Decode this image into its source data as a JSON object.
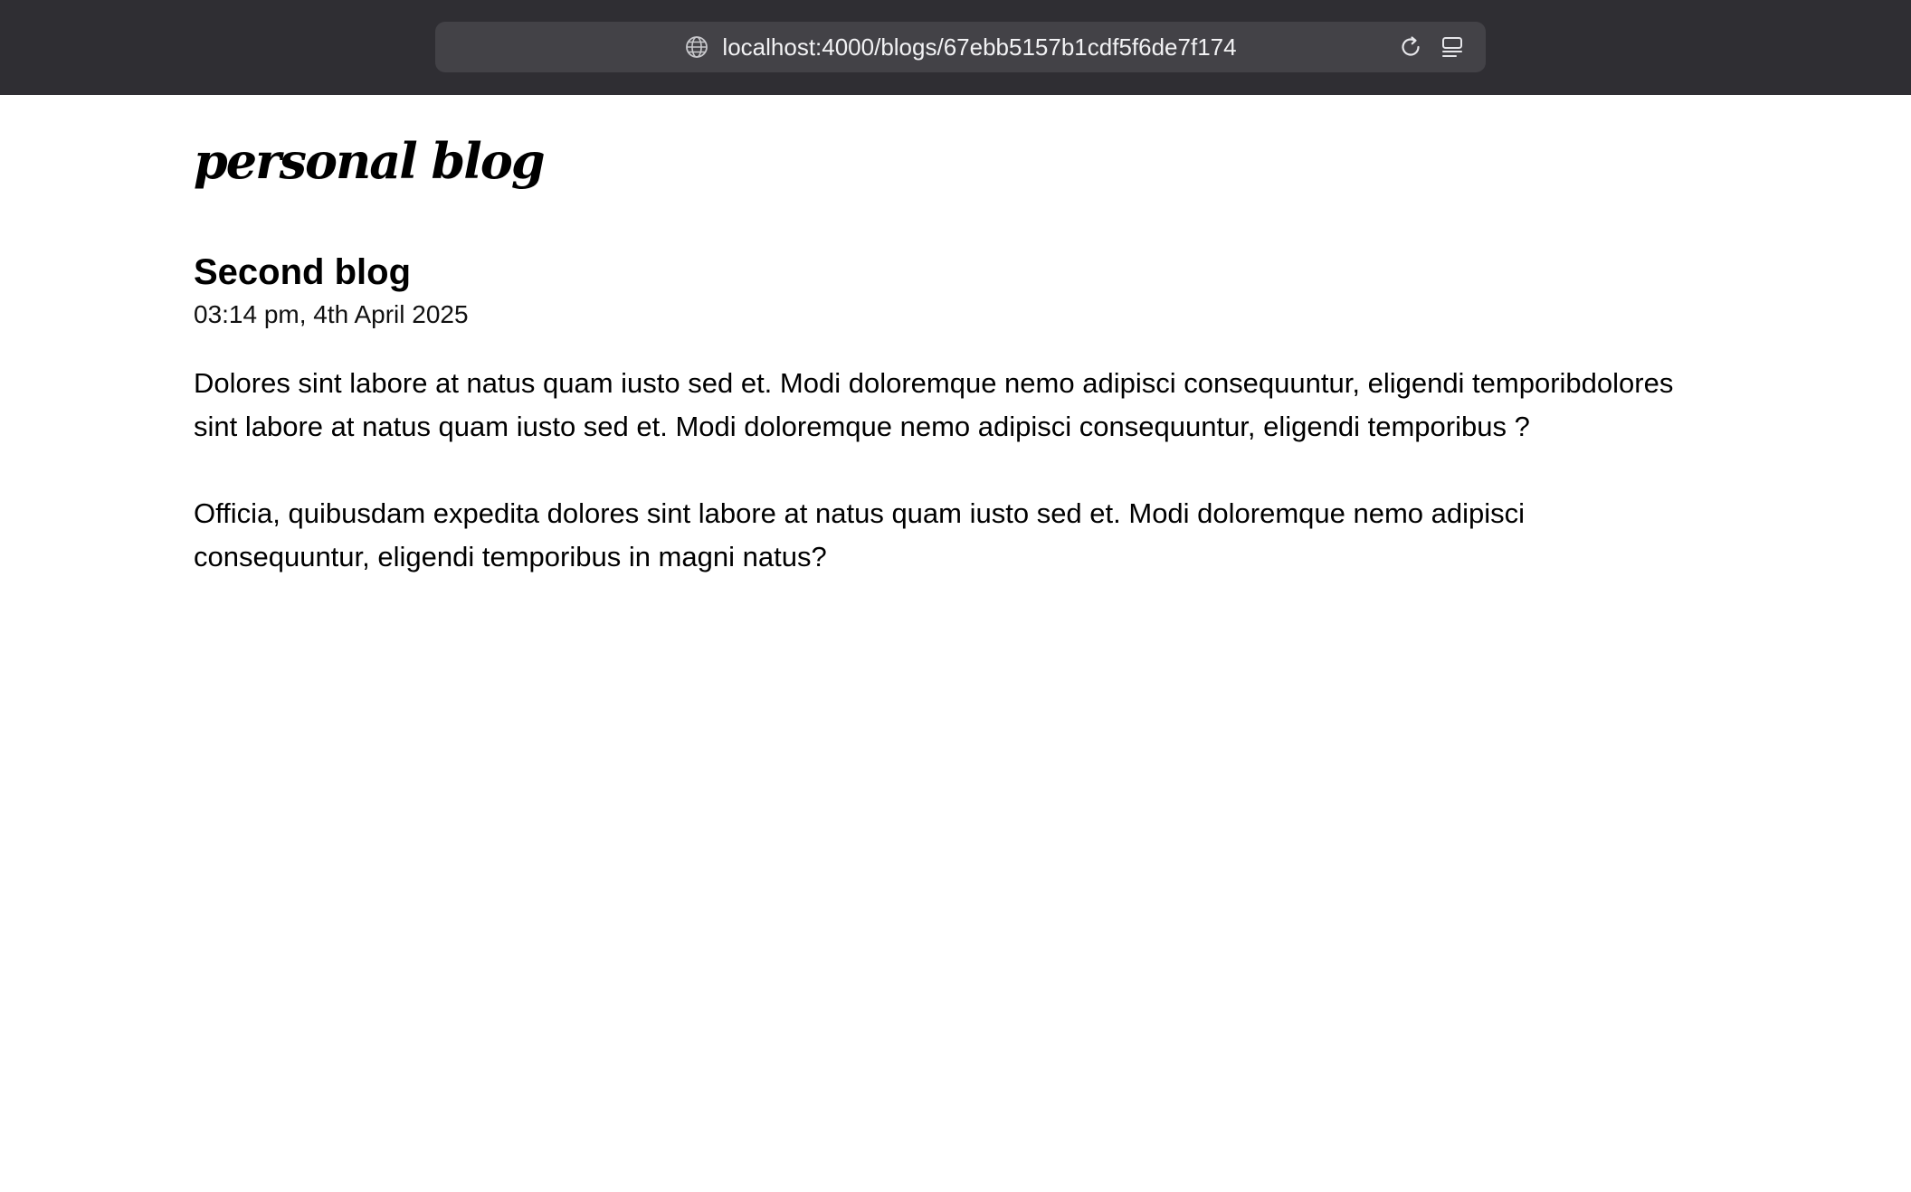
{
  "browser": {
    "url": "localhost:4000/blogs/67ebb5157b1cdf5f6de7f174",
    "icons": {
      "site": "globe-icon",
      "reload": "reload-icon",
      "reader": "reader-mode-icon"
    }
  },
  "site": {
    "title": "personal blog"
  },
  "post": {
    "title": "Second blog",
    "date": "03:14 pm, 4th April 2025",
    "paragraphs": [
      "Dolores sint labore at natus quam iusto sed et. Modi doloremque nemo adipisci consequuntur, eligendi temporibdolores sint labore at natus quam iusto sed et. Modi doloremque nemo adipisci consequuntur, eligendi temporibus ?",
      "Officia, quibusdam expedita dolores sint labore at natus quam iusto sed et. Modi doloremque nemo adipisci consequuntur, eligendi temporibus in magni natus?"
    ]
  },
  "colors": {
    "browser_bar": "#2f2e33",
    "url_field": "#434247",
    "page_background": "#ffffff",
    "text": "#000000"
  }
}
